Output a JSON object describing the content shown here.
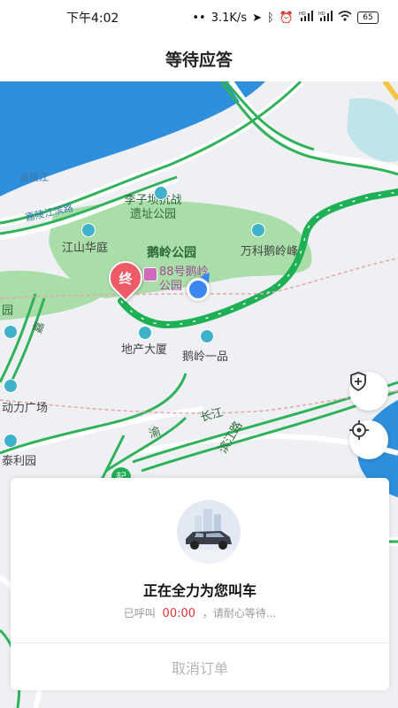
{
  "status_bar": {
    "time": "下午4:02",
    "dots": "••",
    "net_speed": "3.1K/s",
    "battery": "65",
    "hd1": "HD",
    "hd2": "HD"
  },
  "header": {
    "title": "等待应答"
  },
  "map": {
    "labels": {
      "river": "嘉陵江",
      "road1": "嘉陵江滨路",
      "park_memorial": "李子坝抗战\n遗址公园",
      "jiangshan": "江山华庭",
      "eling_park": "鹅岭公园",
      "wanke": "万科鹅岭峰",
      "poi88": "88号鹅岭\n公园",
      "dichan": "地产大厦",
      "eling_yipin": "鹅岭一品",
      "dongli": "动力广场",
      "taili": "泰利园",
      "yuan": "园",
      "road_jia": "嘉",
      "road_ye": "渝",
      "road_chang": "长江",
      "road_binjiang": "滨江路",
      "start_tag": "起"
    },
    "end_marker": "终",
    "accent_route": "#1eb054",
    "water_color": "#2e8fdc",
    "park_color": "#a9dea9"
  },
  "card": {
    "title": "正在全力为您叫车",
    "called_prefix": "已呼叫",
    "timer": "00:00",
    "called_suffix": "，请耐心等待...",
    "cancel_label": "取消订单",
    "timer_color": "#e0323b"
  }
}
